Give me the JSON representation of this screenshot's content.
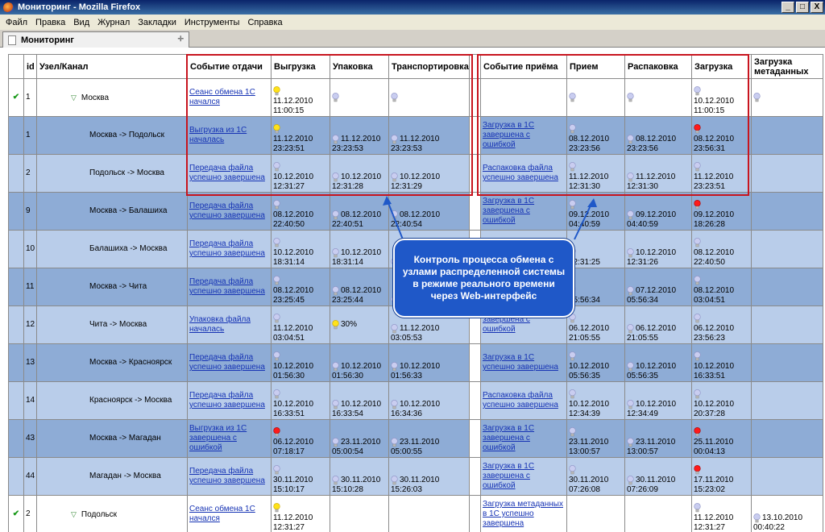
{
  "window": {
    "title": "Мониторинг - Mozilla Firefox",
    "min": "_",
    "max": "□",
    "close": "X"
  },
  "menu": [
    "Файл",
    "Правка",
    "Вид",
    "Журнал",
    "Закладки",
    "Инструменты",
    "Справка"
  ],
  "tab": {
    "label": "Мониторинг",
    "close": "✛"
  },
  "table": {
    "headers": [
      "",
      "id",
      "Узел/Канал",
      "Событие отдачи",
      "Выгрузка",
      "Упаковка",
      "Транспортировка",
      "",
      "Событие приёма",
      "Прием",
      "Распаковка",
      "Загрузка",
      "Загрузка метаданных"
    ],
    "rows": [
      {
        "style": "white",
        "check": true,
        "id": "1",
        "name": "Москва",
        "top": true,
        "send_event": "Сеанс обмена 1С начался",
        "unload": {
          "bulb": "yellow",
          "time": "11.12.2010\n11:00:15"
        },
        "pack": {
          "bulb": "gray",
          "time": ""
        },
        "transport": {
          "bulb": "gray",
          "time": ""
        },
        "recv_event": "",
        "recv": {
          "bulb": "gray",
          "time": ""
        },
        "unpack": {
          "bulb": "gray",
          "time": ""
        },
        "load": {
          "bulb": "gray",
          "time": "10.12.2010\n11:00:15"
        },
        "meta": {
          "bulb": "gray",
          "time": ""
        }
      },
      {
        "style": "dark",
        "id": "1",
        "name": "Москва -> Подольск",
        "send_event": "Выгрузка из 1С началась",
        "unload": {
          "bulb": "yellow",
          "time": "11.12.2010\n23:23:51"
        },
        "pack": {
          "bulb": "gray",
          "time": "11.12.2010\n23:23:53",
          "inline": true
        },
        "transport": {
          "bulb": "gray",
          "time": "11.12.2010\n23:23:53",
          "inline": true
        },
        "recv_event": "Загрузка в 1С завершена с ошибкой",
        "recv": {
          "bulb": "gray",
          "time": "08.12.2010\n23:23:56"
        },
        "unpack": {
          "bulb": "gray",
          "time": "08.12.2010\n23:23:56",
          "inline": true
        },
        "load": {
          "bulb": "red",
          "time": "08.12.2010\n23:56:31"
        },
        "meta": null
      },
      {
        "style": "light",
        "id": "2",
        "name": "Подольск -> Москва",
        "send_event": "Передача файла успешно завершена",
        "unload": {
          "bulb": "gray",
          "time": "10.12.2010\n12:31:27"
        },
        "pack": {
          "bulb": "gray",
          "time": "10.12.2010\n12:31:28",
          "inline": true
        },
        "transport": {
          "bulb": "gray",
          "time": "10.12.2010\n12:31:29",
          "inline": true
        },
        "recv_event": "Распаковка файла успешно завершена",
        "recv": {
          "bulb": "gray",
          "time": "11.12.2010\n12:31:30"
        },
        "unpack": {
          "bulb": "gray",
          "time": "11.12.2010\n12:31:30",
          "inline": true
        },
        "load": {
          "bulb": "gray",
          "time": "11.12.2010\n23:23:51"
        },
        "meta": null
      },
      {
        "style": "dark",
        "id": "9",
        "name": "Москва -> Балашиха",
        "send_event": "Передача файла успешно завершена",
        "unload": {
          "bulb": "gray",
          "time": "08.12.2010\n22:40:50"
        },
        "pack": {
          "bulb": "gray",
          "time": "08.12.2010\n22:40:51",
          "inline": true
        },
        "transport": {
          "bulb": "gray",
          "time": "08.12.2010\n22:40:54",
          "inline": true
        },
        "recv_event": "Загрузка в 1С завершена с ошибкой",
        "recv": {
          "bulb": "gray",
          "time": "09.12.2010\n04:40:59"
        },
        "unpack": {
          "bulb": "gray",
          "time": "09.12.2010\n04:40:59",
          "inline": true
        },
        "load": {
          "bulb": "red",
          "time": "09.12.2010\n18:26:28"
        },
        "meta": null
      },
      {
        "style": "light",
        "id": "10",
        "name": "Балашиха -> Москва",
        "send_event": "Передача файла успешно завершена",
        "unload": {
          "bulb": "gray",
          "time": "10.12.2010\n18:31:14"
        },
        "pack": {
          "bulb": "gray",
          "time": "10.12.2010\n18:31:14",
          "inline": true
        },
        "transport": {
          "bulb": "gray",
          "time": "",
          "inline": true
        },
        "recv_event": "",
        "recv": {
          "bulb": "gray",
          "time": "\n12:31:25"
        },
        "unpack": {
          "bulb": "gray",
          "time": "10.12.2010\n12:31:26",
          "inline": true
        },
        "load": {
          "bulb": "gray",
          "time": "08.12.2010\n22:40:50"
        },
        "meta": null
      },
      {
        "style": "dark",
        "id": "11",
        "name": "Москва -> Чита",
        "send_event": "Передача файла успешно завершена",
        "unload": {
          "bulb": "gray",
          "time": "08.12.2010\n23:25:45"
        },
        "pack": {
          "bulb": "gray",
          "time": "08.12.2010\n23:25:44",
          "inline": true
        },
        "transport": {
          "bulb": "gray",
          "time": "",
          "inline": true
        },
        "recv_event": "",
        "recv": {
          "bulb": "gray",
          "time": "\n05:56:34"
        },
        "unpack": {
          "bulb": "gray",
          "time": "07.12.2010\n05:56:34",
          "inline": true
        },
        "load": {
          "bulb": "gray",
          "time": "08.12.2010\n03:04:51"
        },
        "meta": null
      },
      {
        "style": "light",
        "id": "12",
        "name": "Чита -> Москва",
        "send_event": "Упаковка файла началась",
        "unload": {
          "bulb": "gray",
          "time": "11.12.2010\n03:04:51"
        },
        "pack": {
          "bulb": "yellow",
          "time": "30%",
          "pct": true
        },
        "transport": {
          "bulb": "gray",
          "time": "11.12.2010\n03:05:53",
          "inline": true
        },
        "recv_event": "завершена с ошибкой",
        "recv": {
          "bulb": "gray",
          "time": "06.12.2010\n21:05:55"
        },
        "unpack": {
          "bulb": "gray",
          "time": "06.12.2010\n21:05:55",
          "inline": true
        },
        "load": {
          "bulb": "gray",
          "time": "06.12.2010\n23:56:23"
        },
        "meta": null
      },
      {
        "style": "dark",
        "id": "13",
        "name": "Москва -> Красноярск",
        "send_event": "Передача файла успешно завершена",
        "unload": {
          "bulb": "gray",
          "time": "10.12.2010\n01:56:30"
        },
        "pack": {
          "bulb": "gray",
          "time": "10.12.2010\n01:56:30",
          "inline": true
        },
        "transport": {
          "bulb": "gray",
          "time": "10.12.2010\n01:56:33",
          "inline": true
        },
        "recv_event": "Загрузка в 1С успешно завершена",
        "recv": {
          "bulb": "gray",
          "time": "10.12.2010\n05:56:35"
        },
        "unpack": {
          "bulb": "gray",
          "time": "10.12.2010\n05:56:35",
          "inline": true
        },
        "load": {
          "bulb": "gray",
          "time": "10.12.2010\n16:33:51"
        },
        "meta": null
      },
      {
        "style": "light",
        "id": "14",
        "name": "Красноярск -> Москва",
        "send_event": "Передача файла успешно завершена",
        "unload": {
          "bulb": "gray",
          "time": "10.12.2010\n16:33:51"
        },
        "pack": {
          "bulb": "gray",
          "time": "10.12.2010\n16:33:54",
          "inline": true
        },
        "transport": {
          "bulb": "gray",
          "time": "10.12.2010\n16:34:36",
          "inline": true
        },
        "recv_event": "Распаковка файла успешно завершена",
        "recv": {
          "bulb": "gray",
          "time": "10.12.2010\n12:34:39"
        },
        "unpack": {
          "bulb": "gray",
          "time": "10.12.2010\n12:34:49",
          "inline": true
        },
        "load": {
          "bulb": "gray",
          "time": "10.12.2010\n20:37:28"
        },
        "meta": null
      },
      {
        "style": "dark",
        "id": "43",
        "name": "Москва -> Магадан",
        "send_event": "Выгрузка из 1С завершена с ошибкой",
        "unload": {
          "bulb": "red",
          "time": "06.12.2010\n07:18:17"
        },
        "pack": {
          "bulb": "gray",
          "time": "23.11.2010\n05:00:54",
          "inline": true
        },
        "transport": {
          "bulb": "gray",
          "time": "23.11.2010\n05:00:55",
          "inline": true
        },
        "recv_event": "Загрузка в 1С завершена с ошибкой",
        "recv": {
          "bulb": "gray",
          "time": "23.11.2010\n13:00:57"
        },
        "unpack": {
          "bulb": "gray",
          "time": "23.11.2010\n13:00:57",
          "inline": true
        },
        "load": {
          "bulb": "red",
          "time": "25.11.2010\n00:04:13"
        },
        "meta": null
      },
      {
        "style": "light",
        "id": "44",
        "name": "Магадан -> Москва",
        "send_event": "Передача файла успешно завершена",
        "unload": {
          "bulb": "gray",
          "time": "30.11.2010\n15:10:17"
        },
        "pack": {
          "bulb": "gray",
          "time": "30.11.2010\n15:10:28",
          "inline": true
        },
        "transport": {
          "bulb": "gray",
          "time": "30.11.2010\n15:26:03",
          "inline": true
        },
        "recv_event": "Загрузка в 1С завершена с ошибкой",
        "recv": {
          "bulb": "gray",
          "time": "30.11.2010\n07:26:08"
        },
        "unpack": {
          "bulb": "gray",
          "time": "30.11.2010\n07:26:09",
          "inline": true
        },
        "load": {
          "bulb": "red",
          "time": "17.11.2010\n15:23:02"
        },
        "meta": null
      },
      {
        "style": "white",
        "check": true,
        "id": "2",
        "name": "Подольск",
        "top": true,
        "send_event": "Сеанс обмена 1С начался",
        "unload": {
          "bulb": "yellow",
          "time": "11.12.2010\n12:31:27"
        },
        "pack": {
          "bulb": "none",
          "time": ""
        },
        "transport": {
          "bulb": "none",
          "time": ""
        },
        "recv_event": "Загрузка метаданных в 1С успешно завершена",
        "recv": {
          "bulb": "none",
          "time": ""
        },
        "unpack": {
          "bulb": "none",
          "time": ""
        },
        "load": {
          "bulb": "gray",
          "time": "11.12.2010\n12:31:27"
        },
        "meta": {
          "bulb": "gray",
          "time": "13.10.2010\n00:40:22",
          "inline": true
        }
      }
    ]
  },
  "callout": {
    "text": "Контроль процесса обмена с узлами распределенной системы в режиме реального времени через Web-интерфейс"
  },
  "colors": {
    "row_dark": "#8eacd6",
    "row_light": "#b9cdea",
    "highlight": "#c8141e",
    "callout": "#1f58c8"
  }
}
